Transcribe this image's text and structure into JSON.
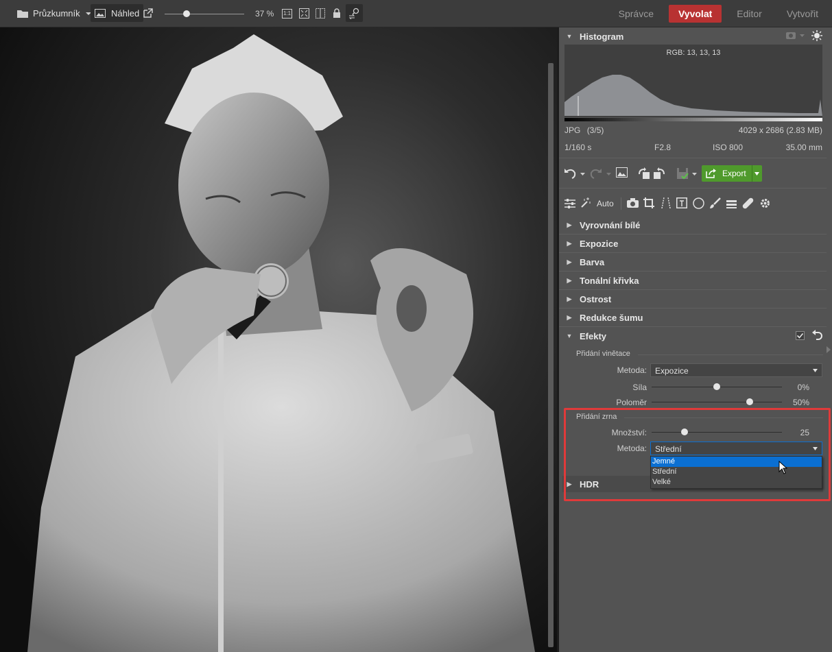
{
  "toolbar": {
    "browser_label": "Průzkumník",
    "preview_label": "Náhled",
    "zoom": "37 %",
    "zoom_fraction": 0.28,
    "fit_label": "1:1"
  },
  "modes": [
    "Správce",
    "Vyvolat",
    "Editor",
    "Vytvořit"
  ],
  "active_mode": "Vyvolat",
  "colors": {
    "accent_red": "#b83232",
    "highlight_blue": "#0b6fd1",
    "export_green": "#4f9a2c",
    "annotation_red": "#e03a3a"
  },
  "histogram": {
    "title": "Histogram",
    "rgb_readout": "RGB: 13, 13, 13"
  },
  "file_info": {
    "format": "JPG",
    "index": "(3/5)",
    "dimensions": "4029 x 2686 (2.83 MB)",
    "shutter": "1/160 s",
    "aperture": "F2.8",
    "iso": "ISO 800",
    "focal": "35.00 mm"
  },
  "actions": {
    "export_label": "Export",
    "auto_label": "Auto"
  },
  "sections": {
    "white_balance": "Vyrovnání bílé",
    "exposure": "Expozice",
    "color": "Barva",
    "tone_curve": "Tonální křivka",
    "sharpness": "Ostrost",
    "noise": "Redukce šumu",
    "effects": "Efekty",
    "hdr": "HDR"
  },
  "vignette": {
    "title": "Přidání vinětace",
    "method_label": "Metoda:",
    "method_value": "Expozice",
    "strength_label": "Síla",
    "strength_value": "0%",
    "strength_fraction": 0.5,
    "radius_label": "Poloměr",
    "radius_value": "50%",
    "radius_fraction": 0.75
  },
  "grain": {
    "title": "Přidání zrna",
    "amount_label": "Množství:",
    "amount_value": "25",
    "amount_fraction": 0.25,
    "method_label": "Metoda:",
    "method_value": "Střední",
    "options": [
      "Jemné",
      "Střední",
      "Velké"
    ],
    "highlighted_option": "Jemné"
  }
}
